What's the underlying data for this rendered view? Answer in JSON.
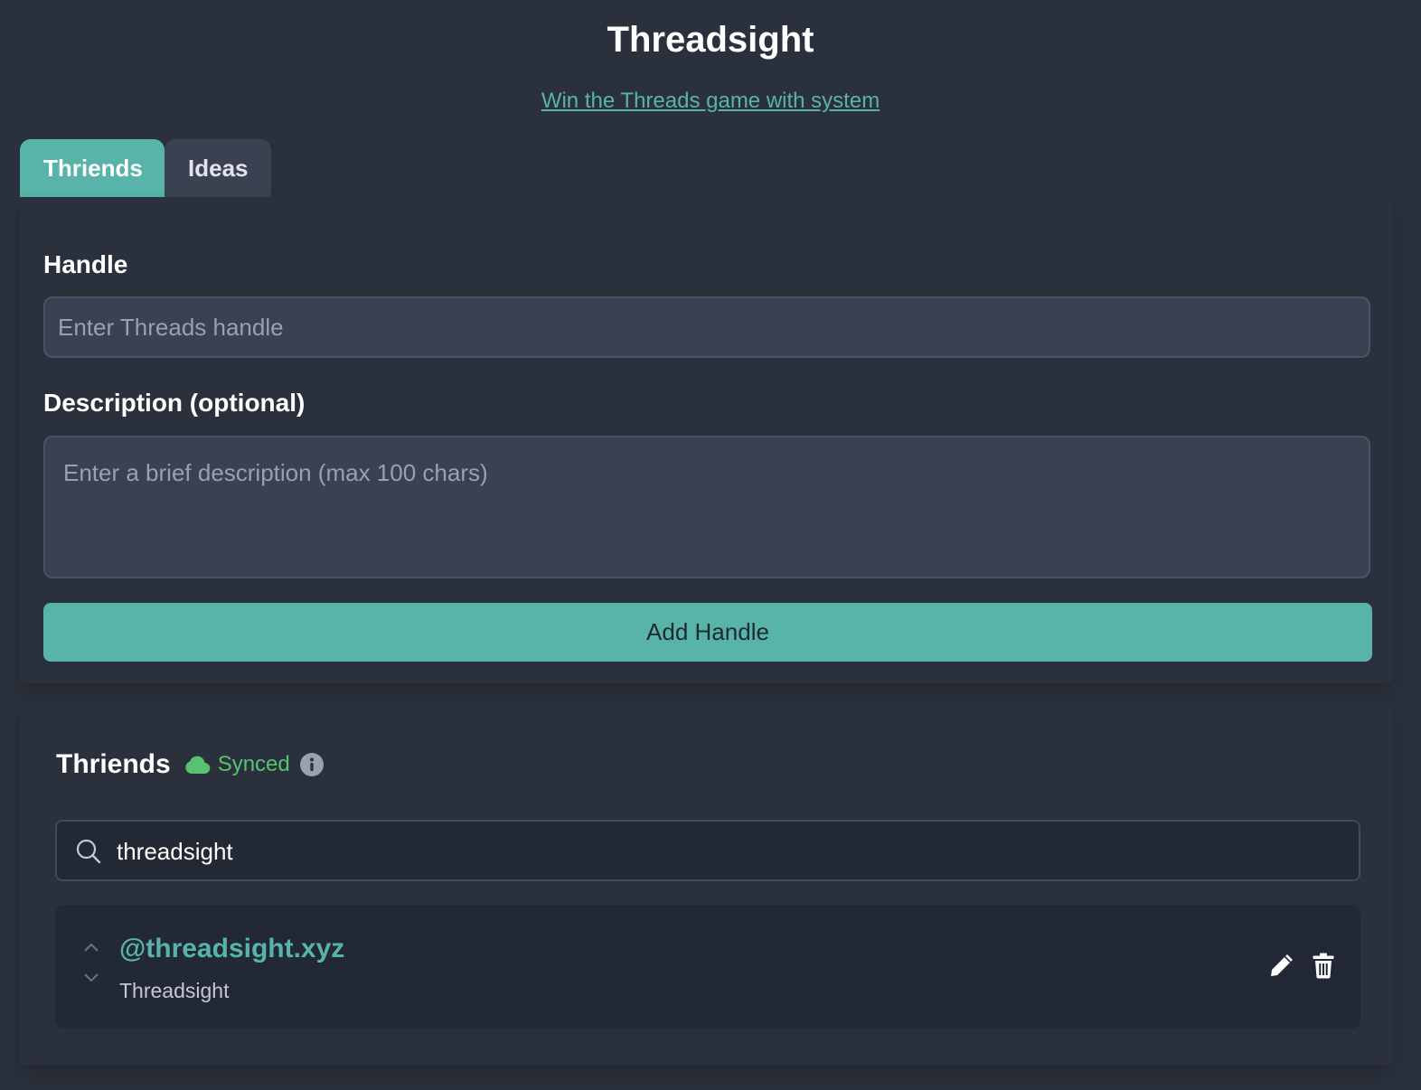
{
  "app": {
    "title": "Threadsight",
    "tagline": "Win the Threads game with system"
  },
  "tabs": [
    {
      "label": "Thriends",
      "active": true
    },
    {
      "label": "Ideas",
      "active": false
    }
  ],
  "form": {
    "handle_label": "Handle",
    "handle_placeholder": "Enter Threads handle",
    "handle_value": "",
    "description_label": "Description (optional)",
    "description_placeholder": "Enter a brief description (max 100 chars)",
    "description_value": "",
    "submit_label": "Add Handle"
  },
  "list": {
    "title": "Thriends",
    "sync_status": "Synced",
    "sync_icon": "cloud-icon",
    "info_icon": "info-icon",
    "search_value": "threadsight",
    "items": [
      {
        "handle": "@threadsight.xyz",
        "description": "Threadsight"
      }
    ]
  },
  "colors": {
    "background": "#2b313c",
    "accent": "#58b3a8",
    "synced": "#57c26f",
    "input_bg": "#3a4152",
    "card_bg": "#222835"
  }
}
